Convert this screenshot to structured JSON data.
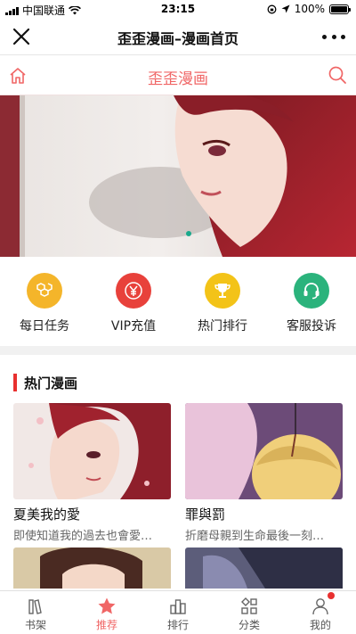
{
  "status_bar": {
    "carrier": "中国联通",
    "time": "23:15",
    "battery": "100%",
    "battery_level": 1.0
  },
  "nav": {
    "title": "歪歪漫画–漫画首页",
    "close_icon": "close-icon",
    "more_icon": "more-icon"
  },
  "header": {
    "title": "歪歪漫画",
    "accent": "#f06666"
  },
  "quick_menu": [
    {
      "label": "每日任务",
      "icon": "task-icon",
      "color": "#f4b52a"
    },
    {
      "label": "VIP充值",
      "icon": "yen-icon",
      "color": "#e8413b"
    },
    {
      "label": "热门排行",
      "icon": "trophy-icon",
      "color": "#f3c318"
    },
    {
      "label": "客服投诉",
      "icon": "headset-icon",
      "color": "#2bb37c"
    }
  ],
  "hot": {
    "title": "热门漫画",
    "cards": [
      {
        "title": "夏美我的愛",
        "desc": "即使知道我的過去也會愛…"
      },
      {
        "title": "罪與罰",
        "desc": "折磨母親到生命最後一刻…"
      }
    ]
  },
  "tabs": [
    {
      "label": "书架",
      "icon": "bookshelf-icon",
      "active": false
    },
    {
      "label": "推荐",
      "icon": "star-icon",
      "active": true
    },
    {
      "label": "排行",
      "icon": "ranking-icon",
      "active": false
    },
    {
      "label": "分类",
      "icon": "category-icon",
      "active": false
    },
    {
      "label": "我的",
      "icon": "profile-icon",
      "active": false,
      "badge": true
    }
  ]
}
